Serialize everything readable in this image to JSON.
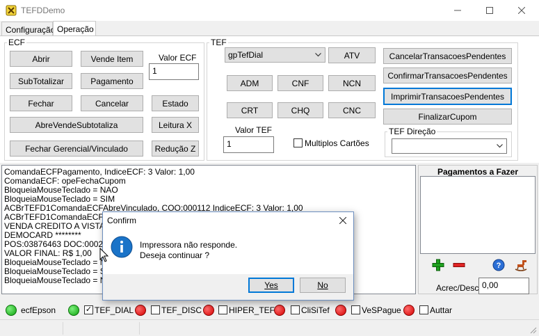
{
  "window": {
    "title": "TEFDDemo",
    "controls": {
      "minimize": "—",
      "maximize": "☐",
      "close": "✕"
    }
  },
  "tabs": [
    {
      "label": "Configuração",
      "active": false
    },
    {
      "label": "Operação",
      "active": true
    }
  ],
  "ecf": {
    "group_label": "ECF",
    "buttons": {
      "abrir": "Abrir",
      "vende_item": "Vende Item",
      "subtotalizar": "SubTotalizar",
      "pagamento": "Pagamento",
      "fechar": "Fechar",
      "cancelar": "Cancelar",
      "estado": "Estado",
      "abre_vende_subtotaliza": "AbreVendeSubtotaliza",
      "leitura_x": "Leitura X",
      "fechar_gerencial": "Fechar Gerencial/Vinculado",
      "reducao_z": "Redução Z"
    },
    "valor_label": "Valor ECF",
    "valor_value": "1"
  },
  "tef": {
    "group_label": "TEF",
    "gp_select": "gpTefDial",
    "buttons": {
      "atv": "ATV",
      "adm": "ADM",
      "cnf": "CNF",
      "ncn": "NCN",
      "crt": "CRT",
      "chq": "CHQ",
      "cnc": "CNC",
      "cancelar_pendentes": "CancelarTransacoesPendentes",
      "confirmar_pendentes": "ConfirmarTransacoesPendentes",
      "imprimir_pendentes": "ImprimirTransacoesPendentes",
      "finalizar_cupom": "FinalizarCupom"
    },
    "valor_label": "Valor TEF",
    "valor_value": "1",
    "multiplos_label": "Multiplos Cartões",
    "direcao_label": "TEF Direção",
    "direcao_value": ""
  },
  "log": {
    "lines": [
      "ComandaECFPagamento, IndiceECF: 3 Valor: 1,00",
      "ComandaECF: opeFechaCupom",
      "BloqueiaMouseTeclado = NAO",
      "BloqueiaMouseTeclado = SIM",
      "ACBrTEFD1ComandaECFAbreVinculado, COO:000112 IndiceECF: 3 Valor: 1,00",
      "ACBrTEFD1ComandaECFImpr",
      "VENDA CREDITO A VISTA",
      "DEMOCARD              ********",
      "POS:03876463  DOC:000286",
      "VALOR FINAL: R$ 1,00",
      "BloqueiaMouseTeclado = NAO",
      "BloqueiaMouseTeclado = SIM",
      "BloqueiaMouseTeclado = NAO"
    ]
  },
  "payments": {
    "title": "Pagamentos a Fazer",
    "acrec_label": "Acrec/Desc",
    "acrec_value": "0,00",
    "icons": [
      "add-icon",
      "remove-icon",
      "help-icon",
      "rocking-horse-icon"
    ]
  },
  "status": {
    "items": [
      {
        "label": "ecfEpson",
        "led": "green",
        "has_checkbox": false,
        "checked": false
      },
      {
        "label": "TEF_DIAL",
        "led": "green",
        "has_checkbox": true,
        "checked": true
      },
      {
        "label": "TEF_DISC",
        "led": "red",
        "has_checkbox": true,
        "checked": false
      },
      {
        "label": "HIPER_TEF",
        "led": "red",
        "has_checkbox": true,
        "checked": false
      },
      {
        "label": "CliSiTef",
        "led": "red",
        "has_checkbox": true,
        "checked": false
      },
      {
        "label": "VeSPague",
        "led": "red",
        "has_checkbox": true,
        "checked": false
      },
      {
        "label": "Auttar",
        "led": "red",
        "has_checkbox": true,
        "checked": false
      }
    ]
  },
  "dialog": {
    "title": "Confirm",
    "message_line1": "Impressora não responde.",
    "message_line2": "Deseja continuar ?",
    "yes": "Yes",
    "no": "No"
  },
  "colors": {
    "accent": "#0078d7",
    "info_icon": "#1a73c8",
    "led_green": "#0da20d",
    "led_red": "#d40000"
  }
}
